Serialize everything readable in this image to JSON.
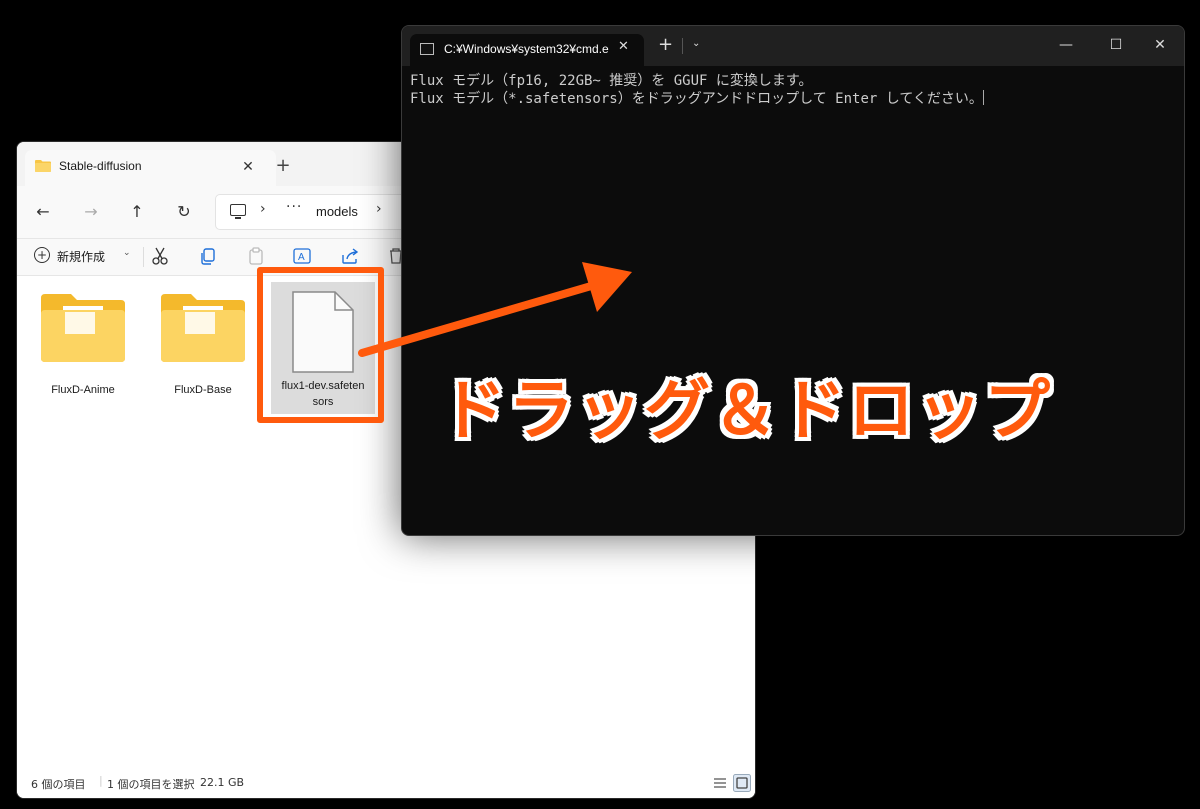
{
  "explorer": {
    "tab_title": "Stable-diffusion",
    "tab_close": "✕",
    "new_tab": "+",
    "nav": {
      "back": "←",
      "forward": "→",
      "up": "↑",
      "refresh": "↻"
    },
    "address": {
      "separator": "›",
      "overflow": "···",
      "crumb": "models"
    },
    "toolbar": {
      "new_label": "新規作成",
      "new_chevron": "⌄"
    },
    "items": [
      {
        "label": "FluxD-Anime",
        "type": "folder-icon"
      },
      {
        "label": "FluxD-Base",
        "type": "folder-icon"
      },
      {
        "label_line1": "flux1-dev.safeten",
        "label_line2": "sors",
        "type": "file-icon"
      }
    ],
    "status": {
      "count": "6 個の項目",
      "selection": "1 個の項目を選択",
      "size": "22.1 GB"
    }
  },
  "cmd": {
    "title": "C:¥Windows¥system32¥cmd.e",
    "close": "✕",
    "plus": "+",
    "dropdown": "⌄",
    "minimize": "—",
    "maximize": "☐",
    "window_close": "✕",
    "lines": [
      "Flux モデル（fp16, 22GB~ 推奨）を GGUF に変換します。",
      "Flux モデル（*.safetensors）をドラッグアンドドロップして Enter してください。"
    ]
  },
  "annotation": {
    "label": "ドラッグ＆ドロップ",
    "color": "#ff5a0d"
  }
}
